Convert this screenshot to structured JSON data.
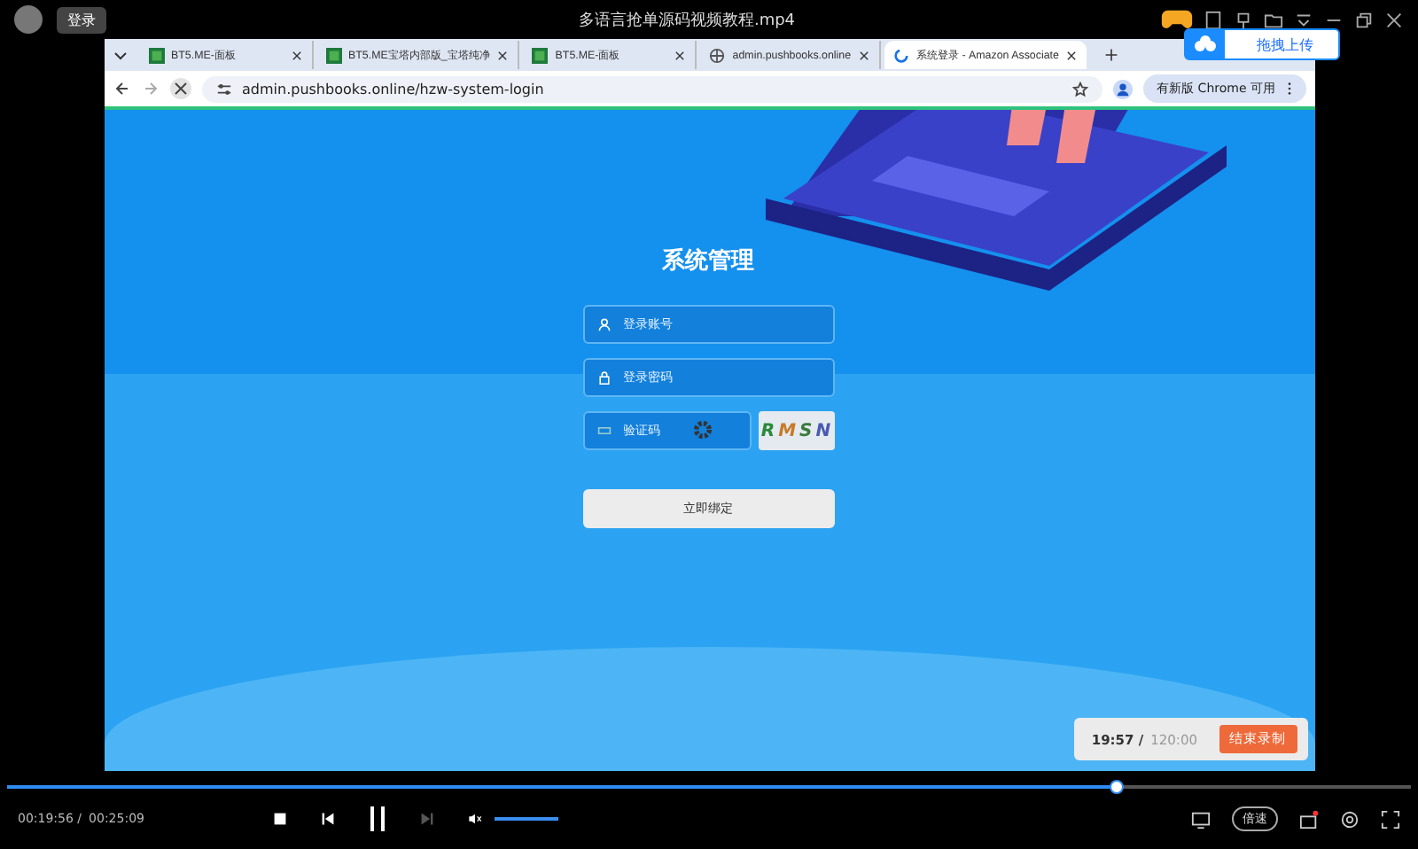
{
  "app": {
    "login_button": "登录",
    "title": "多语言抢单源码视频教程.mp4",
    "upload_button": "拖拽上传"
  },
  "browser": {
    "tabs": [
      {
        "kind": "sheet",
        "title": "BT5.ME-面板",
        "selected": false
      },
      {
        "kind": "sheet",
        "title": "BT5.ME宝塔内部版_宝塔纯净",
        "selected": false
      },
      {
        "kind": "sheet",
        "title": "BT5.ME-面板",
        "selected": false
      },
      {
        "kind": "globe",
        "title": "admin.pushbooks.online",
        "selected": false
      },
      {
        "kind": "loading",
        "title": "系统登录 - Amazon Associate",
        "selected": true
      }
    ],
    "url": "admin.pushbooks.online/hzw-system-login",
    "update_button": "有新版 Chrome 可用"
  },
  "page": {
    "title": "系统管理",
    "fields": [
      {
        "kind": "user",
        "placeholder": "登录账号"
      },
      {
        "kind": "lock",
        "placeholder": "登录密码"
      },
      {
        "kind": "captcha",
        "placeholder": "验证码"
      }
    ],
    "captcha_text": "RMSN",
    "submit_button": "立即绑定"
  },
  "recording": {
    "elapsed": "19:57 /",
    "limit": "120:00",
    "stop_button": "结束录制"
  },
  "player": {
    "progress": {
      "level": 0.79
    },
    "current": "00:19:56 /",
    "total": "00:25:09",
    "volume": {
      "level": 1.0
    },
    "speed_button": "倍速"
  }
}
